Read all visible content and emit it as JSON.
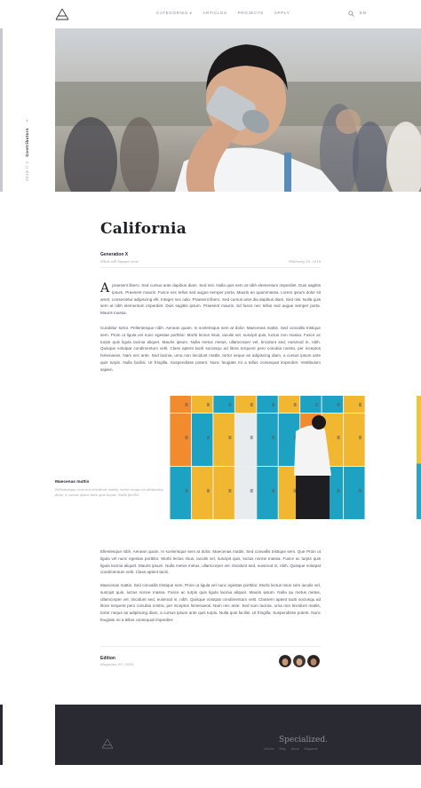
{
  "header": {
    "nav": [
      "CATEGORIES",
      "ARTICLES",
      "PROJECTS",
      "APPLY"
    ],
    "lang": "EN"
  },
  "side_label": {
    "number": "2019 // 2",
    "text": "Contributors"
  },
  "hero": {
    "icon": "hero-photo-girl-drinking"
  },
  "article": {
    "title": "California",
    "meta_label": "Generation X",
    "meta_sub": "What will happen now",
    "meta_date": "February 28, 2018",
    "dropcap": "A",
    "p1": "praesent libero. Sed cursus ante dapibus diam. Sed nisi. Nulla quis sem at nibh elementum imperdiet. Duis sagittis ipsum. Praesent mauris. Fusce nec tellus sed augue semper porta. Mauris an quammassa. Lorem ipsum dolor sit amet, consectetur adipiscing elit. Integer nec odio. Praesent libero. Sed cursus ante dia dapibus diam. Sed nisi. Nulla quis sem at nibh elementum imperdiet. Duis sagittis ipsum. Praesent mauris. Sd fusce nec tellus sed augue semper porta. Mauris massa.",
    "p2": "Curabitur tortor. Pellentesque nibh. Aenean quam. In scelerisque sem at dolor. Maecenas mattis. Sed convallis tristique sem. Proin ut ligula vel nunc egestas porttitor. Morbi lectus risus, iaculis vel, suscipit quis, luctus non massa. Fusce ac turpis quis ligula lacinia aliquet. Mauris ipsum. Nulla metus metus, ullamcorper vel, tincidunt sed, euismod in, nibh. Quisque volutpat condimentum velit. Class aptent taciti sociosqu ad litora torquent pero conubia nostra, per inceptos himenaeos. Nam nec ante. Sed lacinia, urna non tincidunt mattis, tortor neque an adipiscing diam, a cursus ipsum ante quis turpis. Nulla facilisi. Ut fringilla. Suspendisse potent. Nunc feugiate mi a tellus consequat imperdiet. Vestibulum sapien.",
    "caption_title": "Maecenas mattis",
    "caption_text": "Pellentesque urna non tincidunt mattis, tortor neque an adipiscing diam, a cursus ipsum ante quis turpis. Nulla facilisi",
    "p3": "Ellentesque nibh. Aenean quam. In scelerisque sem at dolor. Maecenas mattis. Sed convallis tristique sem. Que Proin ut ligula vel nunc egestas porttitor. Morbi lectus risus, iaculis vel, suscipit quis, luctus nonne massa. Fusce ac turpis quis ligula lacinia aliquet. Mauris ipsum. Nulla metus metus, ullamcorper vel, tincidunt sed, euismod in, nibh. Quisque volutpat condimentum velit. Class aptent taciti.",
    "p4": "Maecenas mattis. Sed convallis tristique sem. Proin ut ligula vel nunc egestas porttitor. Morbi lectus risus sem iaculis vel, suscipit quis, luctus nonne massa. Fusce ac turpis quis ligula lacinia aliquet. Mauris ipsum. Nulla qu metus metus, ullamcorper vel, tincidunt sed, euismod in, nibh. Quisque volutpat condimentum velit. Classem aptent taciti sociosqu ad litora torquent pero conubia nostra, per inceptos himenaeos. Nam nec ante. Sed sum lacinia, urna non tincidunt mattis, tortor neque as adipiscing diam, a cursus ipsum ante quis turpis. Nulla quis facilisi. Ut fringilla. Suspendisse potent. Nunc feugiate mi a tellus consequat imperdiet.",
    "edition_label": "Edition",
    "edition_sub": "Magazine 03, 2018"
  },
  "footer": {
    "title": "Specialized.",
    "links": [
      "Articles",
      "Blog",
      "About",
      "Magazine"
    ]
  },
  "colors": {
    "footer_bg": "#2a2a33",
    "locker_yellow": "#f2b731",
    "locker_orange": "#f28a2e",
    "locker_teal": "#1ea2c4",
    "locker_white": "#e9ecee"
  }
}
